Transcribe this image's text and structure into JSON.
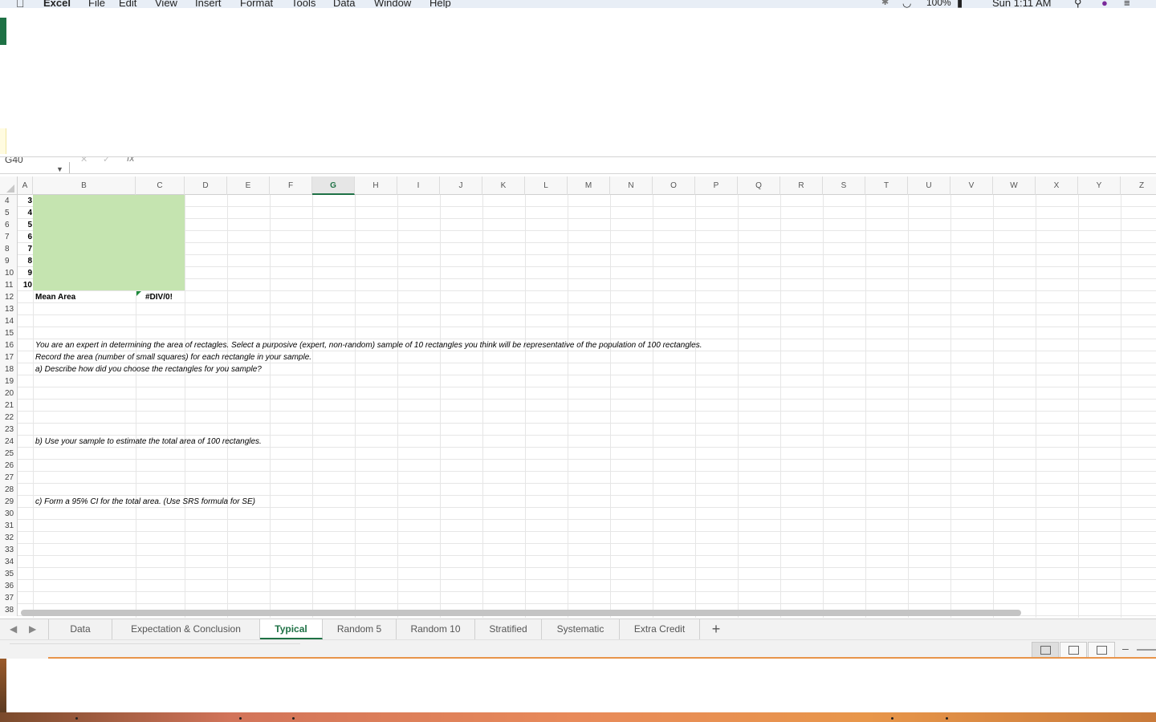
{
  "menubar": {
    "apple": "",
    "app_name": "Excel",
    "items": [
      "File",
      "Edit",
      "View",
      "Insert",
      "Format",
      "Tools",
      "Data",
      "Window",
      "Help"
    ],
    "battery": "100%",
    "clock": "Sun 1:11 AM"
  },
  "formula_bar": {
    "name_box": "G40",
    "fx": "fx"
  },
  "columns": [
    "A",
    "B",
    "C",
    "D",
    "E",
    "F",
    "G",
    "H",
    "I",
    "J",
    "K",
    "L",
    "M",
    "N",
    "O",
    "P",
    "Q",
    "R",
    "S",
    "T",
    "U",
    "V",
    "W",
    "X",
    "Y",
    "Z"
  ],
  "active_column": "G",
  "row_numbers": [
    "4",
    "5",
    "6",
    "7",
    "8",
    "9",
    "10",
    "11",
    "12",
    "13",
    "14",
    "15",
    "16",
    "17",
    "18",
    "19",
    "20",
    "21",
    "22",
    "23",
    "24",
    "25",
    "26",
    "27",
    "28",
    "29",
    "30",
    "31",
    "32",
    "33",
    "34",
    "35",
    "36",
    "37",
    "38"
  ],
  "cells": {
    "a4": "3",
    "a5": "4",
    "a6": "5",
    "a7": "6",
    "a8": "7",
    "a9": "8",
    "a10": "9",
    "a11": "10",
    "b12": "Mean Area",
    "c12": "#DIV/0!",
    "b16": "You are an expert in determining the area of rectagles. Select a purposive (expert, non-random) sample of 10 rectangles you think will be representative of the population of 100 rectangles.",
    "b17": "Record the area (number of small squares) for each rectangle in your sample.",
    "b18": "a) Describe how did you choose the rectangles for you sample?",
    "b24": "b) Use your sample to estimate the total area of 100 rectangles.",
    "b29": "c) Form a 95% CI for the total area. (Use SRS formula for SE)"
  },
  "sheet_tabs": {
    "tabs": [
      "Data",
      "Expectation & Conclusion",
      "Typical",
      "Random 5",
      "Random 10",
      "Stratified",
      "Systematic",
      "Extra Credit"
    ],
    "active": "Typical",
    "add_label": "+"
  },
  "colors": {
    "excel_green": "#1e7145",
    "cell_fill": "#c5e4b0"
  }
}
